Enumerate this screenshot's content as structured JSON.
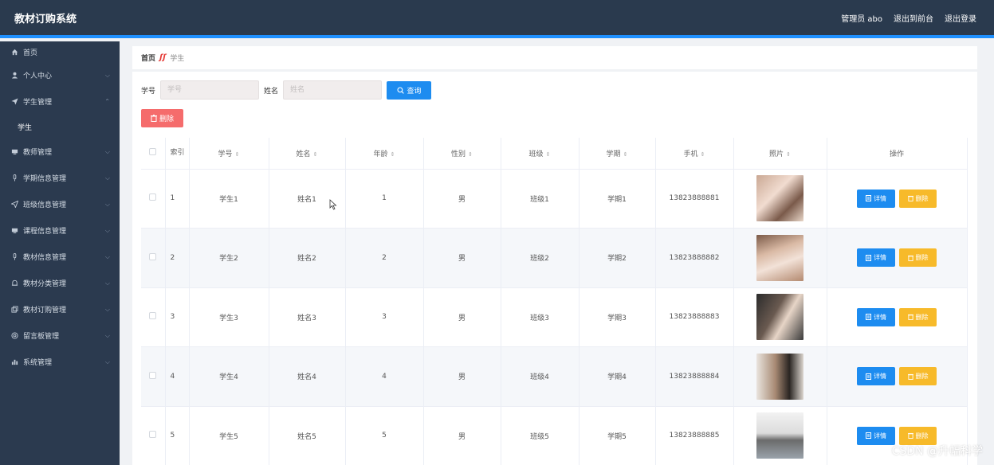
{
  "app": {
    "title": "教材订购系统"
  },
  "header": {
    "links": [
      "管理员 abo",
      "退出到前台",
      "退出登录"
    ]
  },
  "sidebar": {
    "items": [
      {
        "label": "首页",
        "icon": "home-icon",
        "chevron": false
      },
      {
        "label": "个人中心",
        "icon": "user-icon",
        "chevron": true
      },
      {
        "label": "学生管理",
        "icon": "send-icon",
        "chevron": true,
        "expanded": true
      },
      {
        "label": "学生",
        "sub": true
      },
      {
        "label": "教师管理",
        "icon": "tablet-icon",
        "chevron": true
      },
      {
        "label": "学期信息管理",
        "icon": "mic-icon",
        "chevron": true
      },
      {
        "label": "班级信息管理",
        "icon": "send-icon",
        "chevron": true
      },
      {
        "label": "课程信息管理",
        "icon": "tablet-icon",
        "chevron": true
      },
      {
        "label": "教材信息管理",
        "icon": "mic-icon",
        "chevron": true
      },
      {
        "label": "教材分类管理",
        "icon": "bell-icon",
        "chevron": true
      },
      {
        "label": "教材订购管理",
        "icon": "copy-icon",
        "chevron": true
      },
      {
        "label": "留言板管理",
        "icon": "help-icon",
        "chevron": true
      },
      {
        "label": "系统管理",
        "icon": "bar-chart-icon",
        "chevron": true
      }
    ]
  },
  "breadcrumb": {
    "home": "首页",
    "current": "学生"
  },
  "search": {
    "fields": [
      {
        "label": "学号",
        "placeholder": "学号"
      },
      {
        "label": "姓名",
        "placeholder": "姓名"
      }
    ],
    "button": "查询",
    "delete_button": "删除"
  },
  "table": {
    "columns": [
      "索引",
      "学号",
      "姓名",
      "年龄",
      "性别",
      "班级",
      "学期",
      "手机",
      "照片",
      "操作"
    ],
    "rows": [
      {
        "index": "1",
        "id": "学生1",
        "name": "姓名1",
        "age": "1",
        "gender": "男",
        "class": "班级1",
        "term": "学期1",
        "phone": "13823888881"
      },
      {
        "index": "2",
        "id": "学生2",
        "name": "姓名2",
        "age": "2",
        "gender": "男",
        "class": "班级2",
        "term": "学期2",
        "phone": "13823888882"
      },
      {
        "index": "3",
        "id": "学生3",
        "name": "姓名3",
        "age": "3",
        "gender": "男",
        "class": "班级3",
        "term": "学期3",
        "phone": "13823888883"
      },
      {
        "index": "4",
        "id": "学生4",
        "name": "姓名4",
        "age": "4",
        "gender": "男",
        "class": "班级4",
        "term": "学期4",
        "phone": "13823888884"
      },
      {
        "index": "5",
        "id": "学生5",
        "name": "姓名5",
        "age": "5",
        "gender": "男",
        "class": "班级5",
        "term": "学期5",
        "phone": "13823888885"
      }
    ],
    "detail_label": "详情",
    "delete_label": "删除"
  },
  "watermark": "CSDN @升幅科学",
  "colors": {
    "header": "#2a3a4e",
    "accent": "#1d8cf0",
    "danger": "#f56c6c",
    "warning": "#f7ba2a"
  }
}
